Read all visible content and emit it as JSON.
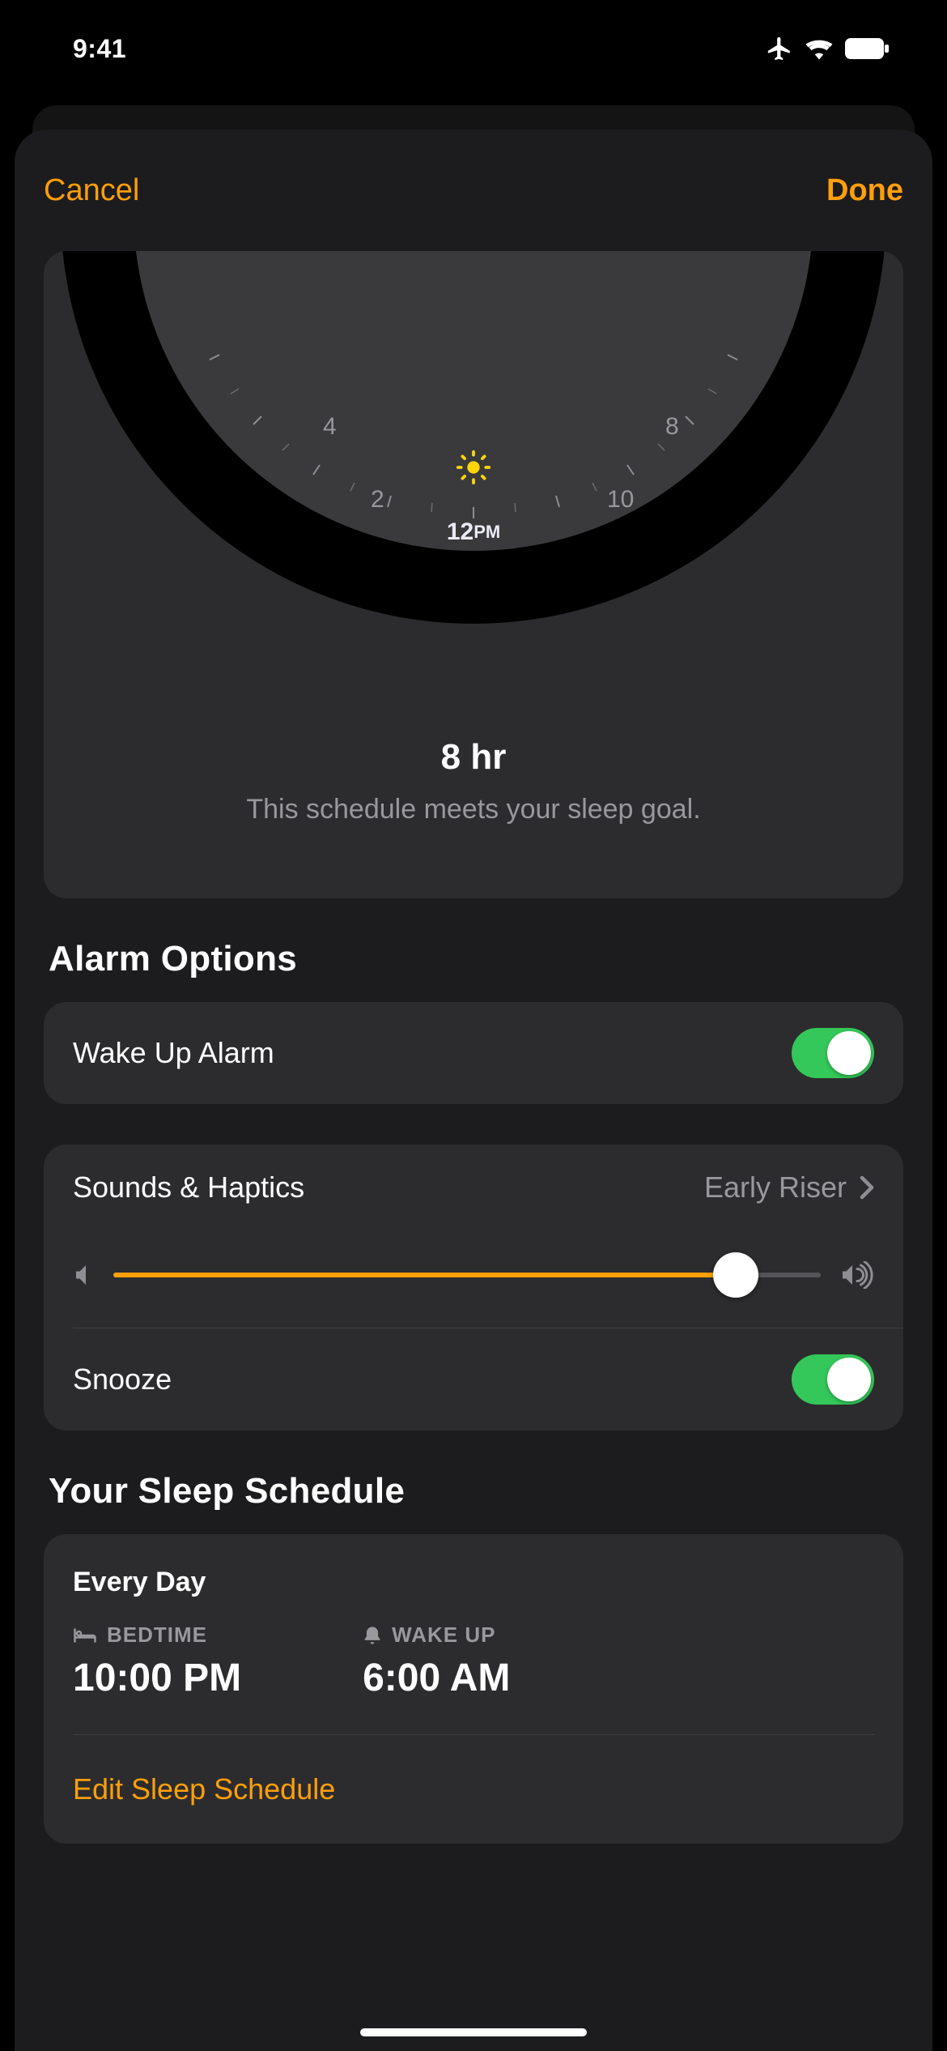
{
  "status": {
    "time": "9:41"
  },
  "header": {
    "cancel": "Cancel",
    "done": "Done"
  },
  "clock": {
    "noon": "12",
    "noon_ampm": "PM",
    "h2": "2",
    "h4": "4",
    "h8": "8",
    "h10": "10",
    "duration": "8 hr",
    "goal_text": "This schedule meets your sleep goal."
  },
  "alarm": {
    "section_title": "Alarm Options",
    "wake_label": "Wake Up Alarm",
    "sounds_label": "Sounds & Haptics",
    "sounds_value": "Early Riser",
    "snooze_label": "Snooze"
  },
  "schedule": {
    "section_title": "Your Sleep Schedule",
    "frequency": "Every Day",
    "bedtime_label": "BEDTIME",
    "bedtime_value": "10:00 PM",
    "wake_label": "WAKE UP",
    "wake_value": "6:00 AM",
    "edit_link": "Edit Sleep Schedule"
  }
}
